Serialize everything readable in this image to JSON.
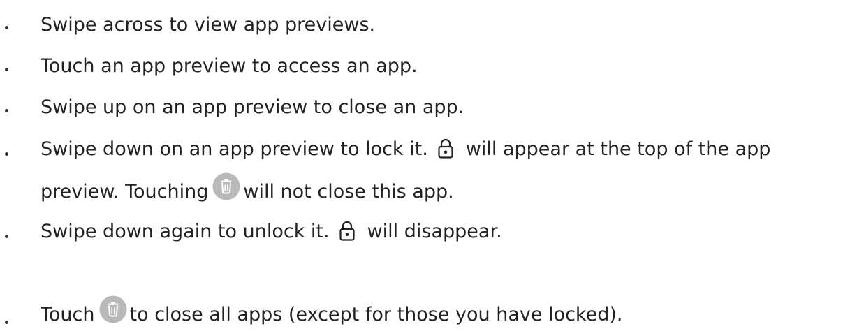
{
  "items": [
    {
      "text": "Swipe across to view app previews."
    },
    {
      "text": "Touch an app preview to access an app."
    },
    {
      "text": "Swipe up on an app preview to close an app."
    },
    {
      "before": "Swipe down on an app preview to lock it.",
      "after": "will appear at the top of the app",
      "cont_before": "preview. Touching",
      "cont_after": "will not close this app."
    },
    {
      "before": "Swipe down again to unlock it.",
      "after": "will disappear."
    },
    {
      "before": "Touch",
      "after": "to close all apps (except for those you have locked)."
    }
  ],
  "icons": {
    "lock": "lock-icon",
    "trash": "trash-icon"
  },
  "colors": {
    "text": "#222222",
    "icon_stroke": "#222222",
    "trash_circle": "#b9b9b9",
    "trash_glyph": "#ffffff"
  }
}
